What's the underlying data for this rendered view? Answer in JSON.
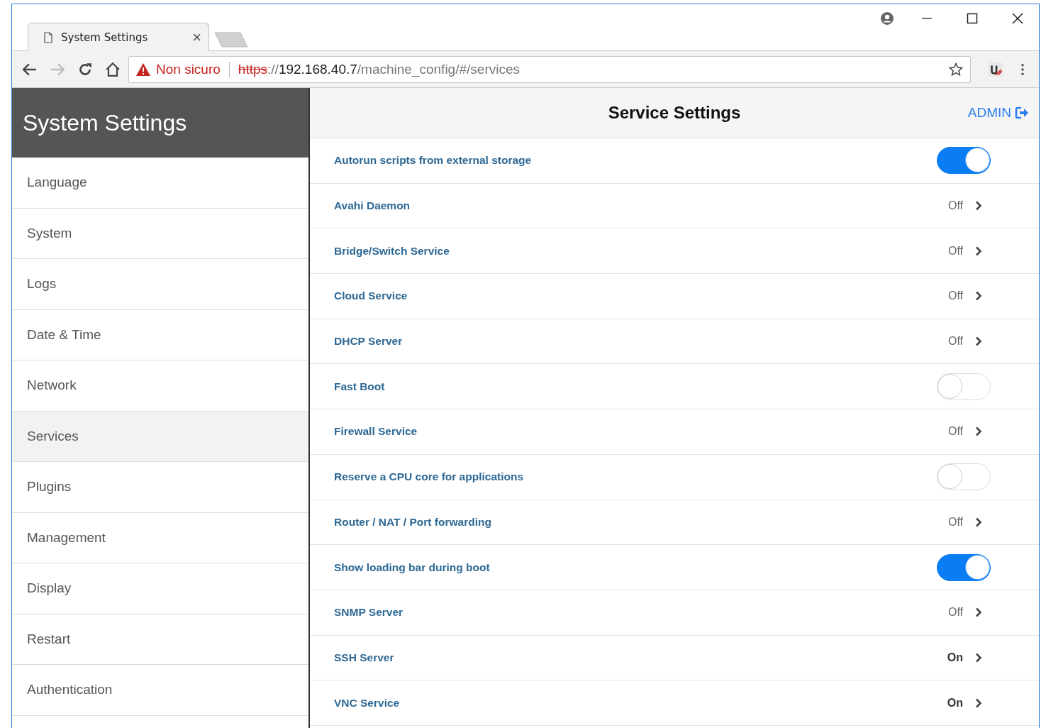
{
  "browser": {
    "tab": {
      "title": "System Settings",
      "close": "×"
    },
    "security": "Non sicuro",
    "url": {
      "scheme": "https",
      "separator": "://",
      "host": "192.168.40.7",
      "path": "/machine_config/#/services"
    }
  },
  "sidebar": {
    "title": "System Settings",
    "items": [
      {
        "label": "Language",
        "selected": false
      },
      {
        "label": "System",
        "selected": false
      },
      {
        "label": "Logs",
        "selected": false
      },
      {
        "label": "Date & Time",
        "selected": false
      },
      {
        "label": "Network",
        "selected": false
      },
      {
        "label": "Services",
        "selected": true
      },
      {
        "label": "Plugins",
        "selected": false
      },
      {
        "label": "Management",
        "selected": false
      },
      {
        "label": "Display",
        "selected": false
      },
      {
        "label": "Restart",
        "selected": false
      },
      {
        "label": "Authentication",
        "selected": false
      }
    ]
  },
  "header": {
    "title": "Service Settings",
    "user": "ADMIN"
  },
  "services": [
    {
      "kind": "toggle",
      "label": "Autorun scripts from external storage",
      "on": true
    },
    {
      "kind": "link",
      "label": "Avahi Daemon",
      "status": "Off",
      "on": false
    },
    {
      "kind": "link",
      "label": "Bridge/Switch Service",
      "status": "Off",
      "on": false
    },
    {
      "kind": "link",
      "label": "Cloud Service",
      "status": "Off",
      "on": false
    },
    {
      "kind": "link",
      "label": "DHCP Server",
      "status": "Off",
      "on": false
    },
    {
      "kind": "toggle",
      "label": "Fast Boot",
      "on": false
    },
    {
      "kind": "link",
      "label": "Firewall Service",
      "status": "Off",
      "on": false
    },
    {
      "kind": "toggle",
      "label": "Reserve a CPU core for applications",
      "on": false
    },
    {
      "kind": "link",
      "label": "Router / NAT / Port forwarding",
      "status": "Off",
      "on": false
    },
    {
      "kind": "toggle",
      "label": "Show loading bar during boot",
      "on": true
    },
    {
      "kind": "link",
      "label": "SNMP Server",
      "status": "Off",
      "on": false
    },
    {
      "kind": "link",
      "label": "SSH Server",
      "status": "On",
      "on": true
    },
    {
      "kind": "link",
      "label": "VNC Service",
      "status": "On",
      "on": true
    }
  ]
}
